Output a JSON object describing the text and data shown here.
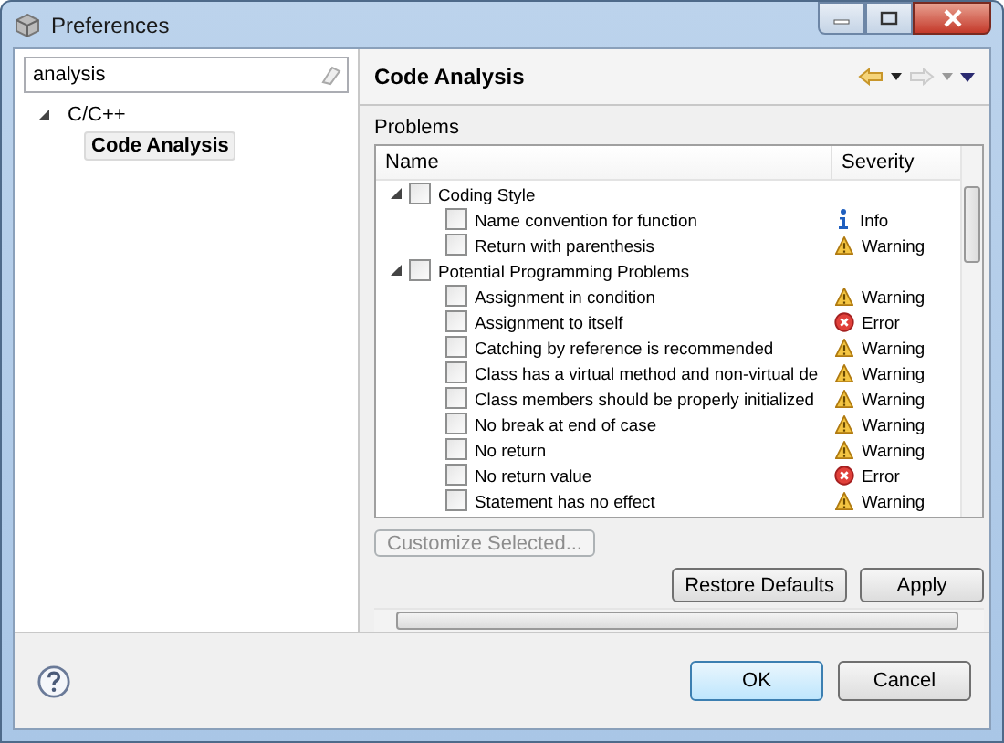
{
  "window": {
    "title": "Preferences"
  },
  "search": {
    "value": "analysis"
  },
  "nav_tree": [
    {
      "label": "C/C++",
      "expanded": true,
      "selected": false,
      "children": [
        {
          "label": "Code Analysis",
          "selected": true
        }
      ]
    }
  ],
  "page": {
    "title": "Code Analysis",
    "section": "Problems"
  },
  "table": {
    "columns": [
      "Name",
      "Severity"
    ],
    "groups": [
      {
        "name": "Coding Style",
        "expanded": true,
        "checked": false,
        "children": [
          {
            "name": "Name convention for function",
            "checked": false,
            "severity": "Info",
            "kind": "info"
          },
          {
            "name": "Return with parenthesis",
            "checked": false,
            "severity": "Warning",
            "kind": "warning"
          }
        ]
      },
      {
        "name": "Potential Programming Problems",
        "expanded": true,
        "checked": false,
        "children": [
          {
            "name": "Assignment in condition",
            "checked": false,
            "severity": "Warning",
            "kind": "warning"
          },
          {
            "name": "Assignment to itself",
            "checked": false,
            "severity": "Error",
            "kind": "error"
          },
          {
            "name": "Catching by reference is recommended",
            "checked": false,
            "severity": "Warning",
            "kind": "warning"
          },
          {
            "name": "Class has a virtual method and non-virtual de",
            "checked": false,
            "severity": "Warning",
            "kind": "warning"
          },
          {
            "name": "Class members should be properly initialized",
            "checked": false,
            "severity": "Warning",
            "kind": "warning"
          },
          {
            "name": "No break at end of case",
            "checked": false,
            "severity": "Warning",
            "kind": "warning"
          },
          {
            "name": "No return",
            "checked": false,
            "severity": "Warning",
            "kind": "warning"
          },
          {
            "name": "No return value",
            "checked": false,
            "severity": "Error",
            "kind": "error"
          },
          {
            "name": "Statement has no effect",
            "checked": false,
            "severity": "Warning",
            "kind": "warning"
          }
        ]
      }
    ]
  },
  "customize_button": {
    "label": "Customize Selected...",
    "disabled": true
  },
  "page_buttons": [
    "Restore Defaults",
    "Apply"
  ],
  "dialog_buttons": [
    {
      "label": "OK",
      "default": true
    },
    {
      "label": "Cancel",
      "default": false
    }
  ]
}
